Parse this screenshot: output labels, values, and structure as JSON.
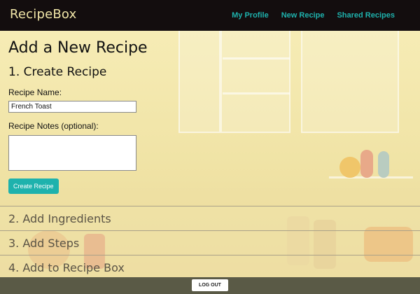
{
  "app": {
    "brand": "RecipeBox"
  },
  "nav": {
    "items": [
      "My Profile",
      "New Recipe",
      "Shared Recipes"
    ]
  },
  "page": {
    "title": "Add a New Recipe"
  },
  "step1": {
    "title": "1. Create Recipe",
    "name_label": "Recipe Name:",
    "name_value": "French Toast",
    "notes_label": "Recipe Notes (optional):",
    "notes_value": "",
    "button": "Create Recipe"
  },
  "steps": [
    "2. Add Ingredients",
    "3. Add Steps",
    "4. Add to Recipe Box"
  ],
  "footer": {
    "logout": "LOG OUT"
  },
  "colors": {
    "accent": "#1eb2ad",
    "nav_bg": "#130d0e",
    "footer_bg": "#5a5a46",
    "background": "#f3e7a9"
  }
}
